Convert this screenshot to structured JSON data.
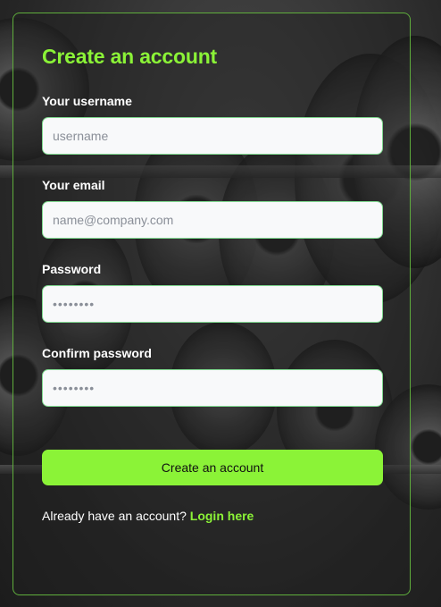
{
  "form": {
    "title": "Create an account",
    "fields": [
      {
        "label": "Your username",
        "placeholder": "username"
      },
      {
        "label": "Your email",
        "placeholder": "name@company.com"
      },
      {
        "label": "Password",
        "placeholder": "••••••••"
      },
      {
        "label": "Confirm password",
        "placeholder": "••••••••"
      }
    ],
    "submit_label": "Create an account",
    "footer_text": "Already have an account? ",
    "login_link": "Login here"
  },
  "colors": {
    "accent": "#8bf337",
    "border": "#5fae3c",
    "input_bg": "#f8f9fa"
  }
}
